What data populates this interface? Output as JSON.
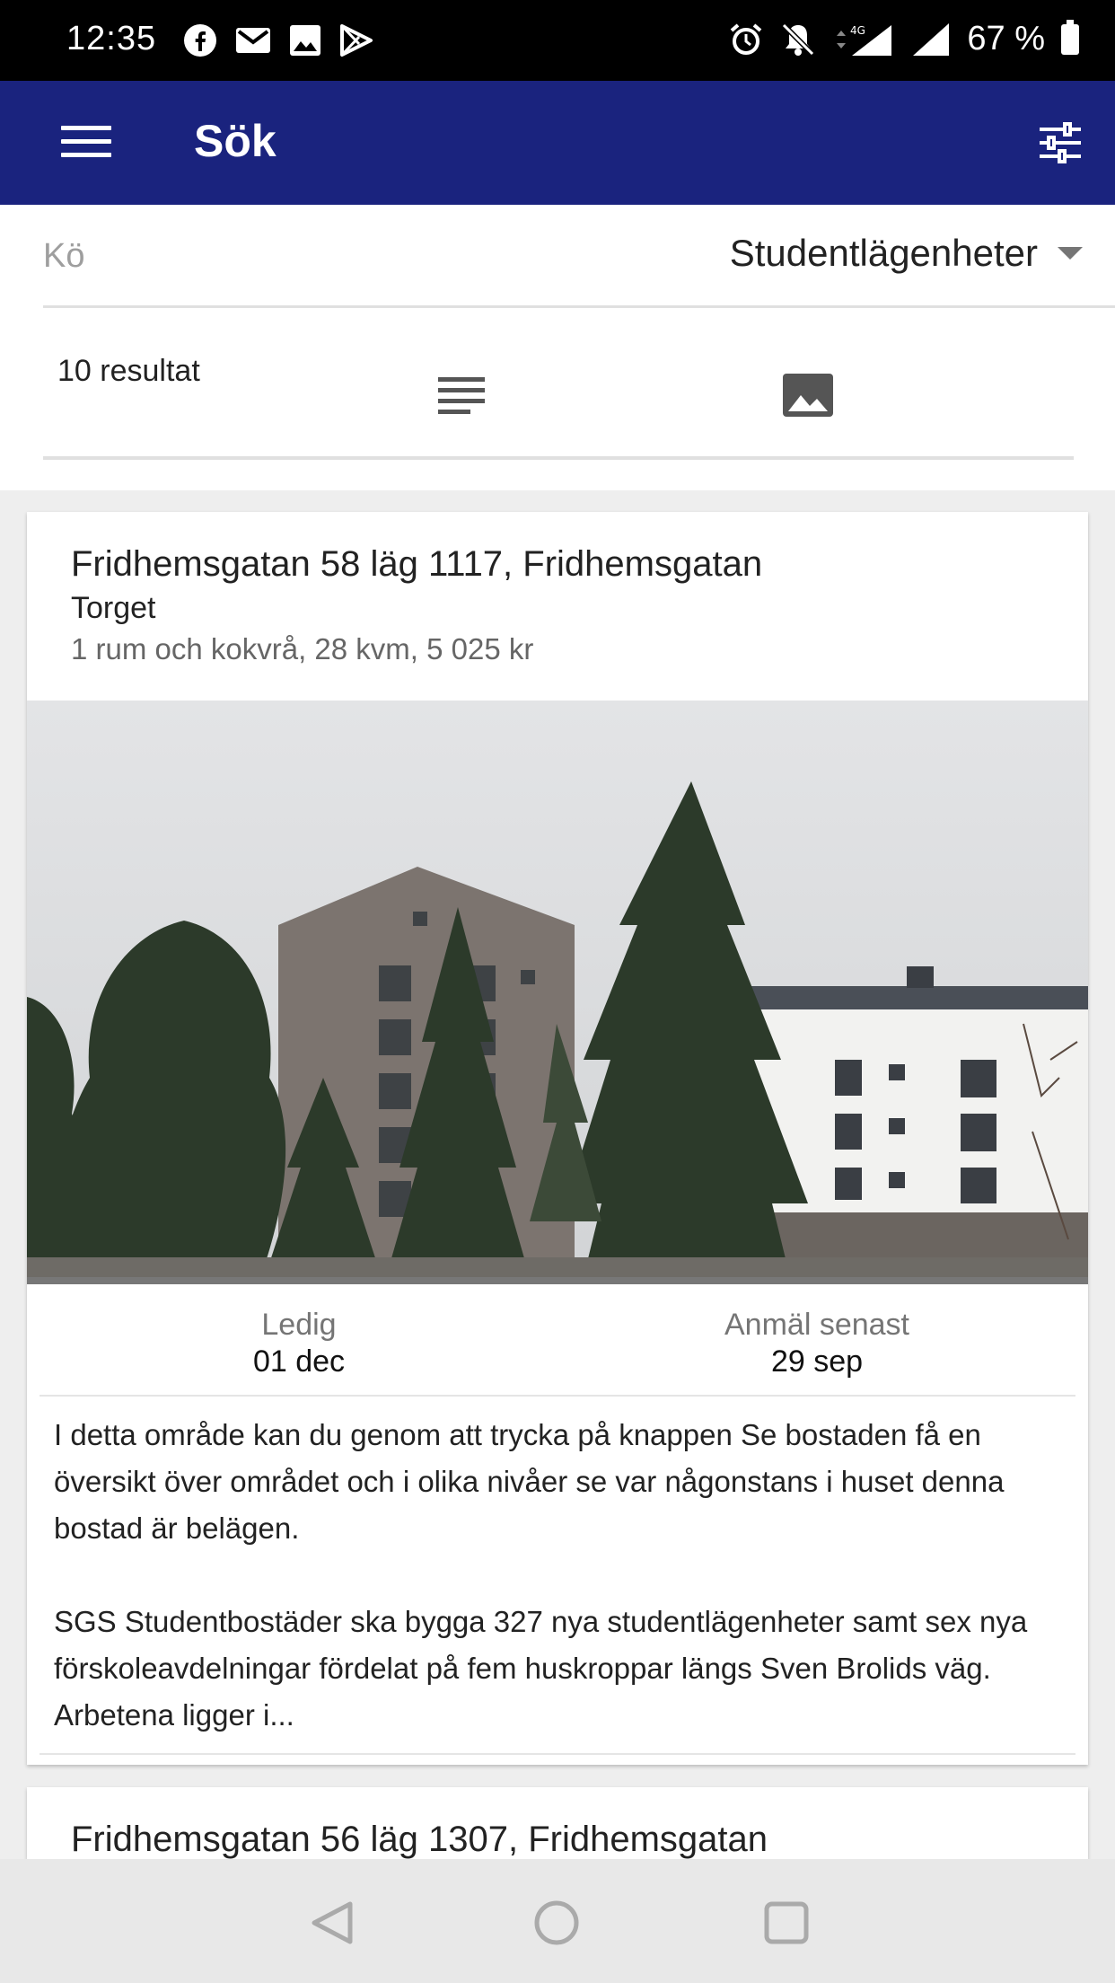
{
  "status_bar": {
    "time": "12:35",
    "left_icons": [
      "facebook-icon",
      "gmail-icon",
      "image-icon",
      "play-store-icon"
    ],
    "right_icons": [
      "alarm-icon",
      "notifications-off-icon",
      "4g-signal-icon",
      "signal-icon",
      "battery-icon"
    ],
    "battery": "67 %"
  },
  "appbar": {
    "title": "Sök",
    "background": "#1a237e"
  },
  "filters": {
    "queue_label": "Kö",
    "queue_value": "Studentlägenheter",
    "results_count": "10 resultat"
  },
  "listings": [
    {
      "title": "Fridhemsgatan 58 läg 1117, Fridhemsgatan",
      "area": "Torget",
      "info": "1 rum och kokvrå, 28 kvm, 5 025 kr",
      "available_label": "Ledig",
      "available_value": "01 dec",
      "deadline_label": "Anmäl senast",
      "deadline_value": "29 sep",
      "description": "I detta område kan du genom att trycka på knappen Se bostaden få en översikt över området och i olika nivåer  se var någonstans  i huset denna bostad är belägen.\n\nSGS Studentbostäder ska bygga 327 nya studentlägenheter samt sex nya förskoleavdelningar fördelat på fem huskroppar längs Sven Brolids väg. Arbetena ligger i..."
    },
    {
      "title": "Fridhemsgatan 56 läg 1307, Fridhemsgatan"
    }
  ],
  "navbar": {
    "icons": [
      "back-icon",
      "home-icon",
      "recents-icon"
    ]
  }
}
